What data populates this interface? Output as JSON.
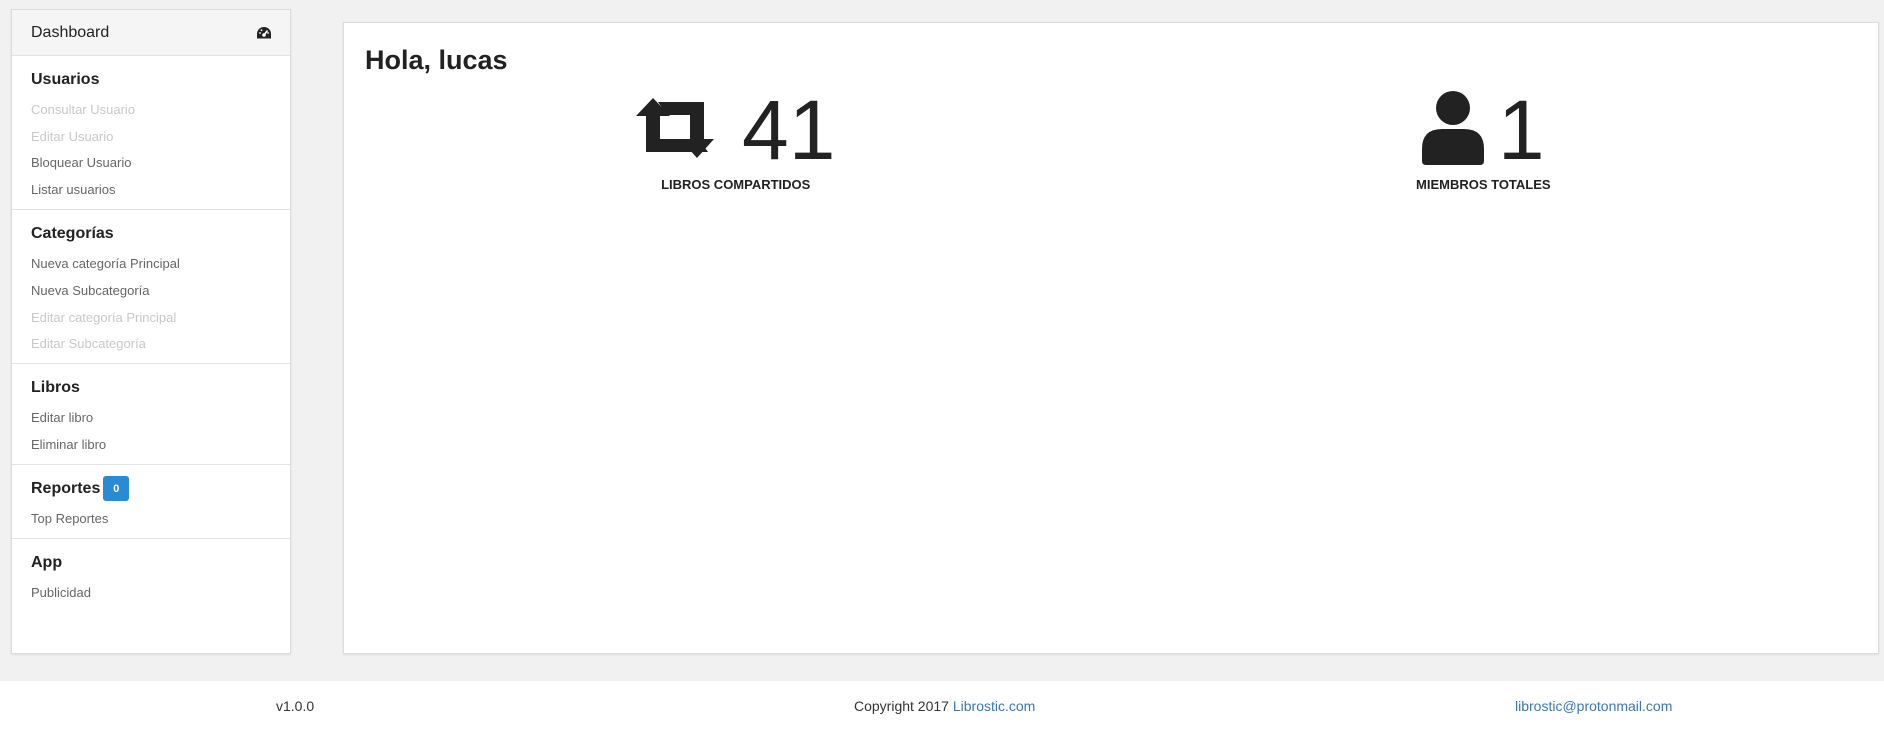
{
  "sidebar": {
    "header": {
      "label": "Dashboard",
      "icon": "dashboard-gauge-icon"
    },
    "sections": [
      {
        "title": "Usuarios",
        "items": [
          {
            "label": "Consultar Usuario",
            "disabled": true
          },
          {
            "label": "Editar Usuario",
            "disabled": true
          },
          {
            "label": "Bloquear Usuario",
            "disabled": false
          },
          {
            "label": "Listar usuarios",
            "disabled": false
          }
        ]
      },
      {
        "title": "Categorías",
        "items": [
          {
            "label": "Nueva categoría Principal",
            "disabled": false
          },
          {
            "label": "Nueva Subcategoría",
            "disabled": false
          },
          {
            "label": "Editar categoría Principal",
            "disabled": true
          },
          {
            "label": "Editar Subcategoría",
            "disabled": true
          }
        ]
      },
      {
        "title": "Libros",
        "items": [
          {
            "label": "Editar libro",
            "disabled": false
          },
          {
            "label": "Eliminar libro",
            "disabled": false
          }
        ]
      },
      {
        "title": "Reportes",
        "badge": "0",
        "items": [
          {
            "label": "Top Reportes",
            "disabled": false
          }
        ]
      },
      {
        "title": "App",
        "items": [
          {
            "label": "Publicidad",
            "disabled": false
          }
        ]
      }
    ]
  },
  "main": {
    "greeting": "Hola, lucas",
    "stats": [
      {
        "icon": "retweet-share-icon",
        "value": "41",
        "label": "LIBROS COMPARTIDOS"
      },
      {
        "icon": "user-icon",
        "value": "1",
        "label": "MIEMBROS TOTALES"
      }
    ]
  },
  "footer": {
    "version": "v1.0.0",
    "copyright_prefix": "Copyright 2017 ",
    "copyright_link": "Librostic.com",
    "email": "librostic@protonmail.com"
  },
  "colors": {
    "badge": "#2b8ad4",
    "link": "#3a78b5",
    "disabled_text": "#c8c8c8",
    "background": "#f1f1f1"
  }
}
